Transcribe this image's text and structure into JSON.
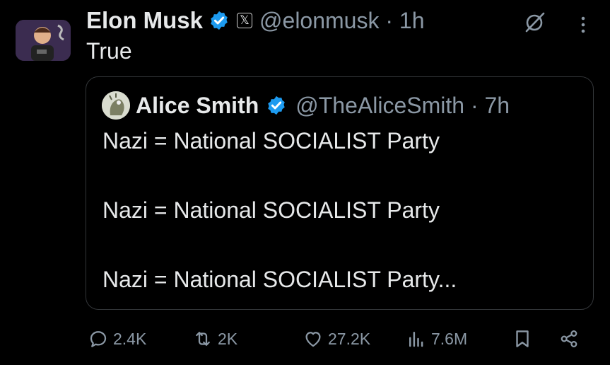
{
  "tweet": {
    "author_name": "Elon Musk",
    "handle_time": "@elonmusk · 1h",
    "text": "True",
    "x_badge": "𝕏"
  },
  "quote": {
    "author_name": "Alice Smith",
    "handle_time": "@TheAliceSmith · 7h",
    "lines": [
      "Nazi = National SOCIALIST Party",
      "Nazi = National SOCIALIST Party",
      "Nazi = National SOCIALIST Party..."
    ]
  },
  "actions": {
    "replies": "2.4K",
    "reposts": "2K",
    "likes": "27.2K",
    "views": "7.6M"
  },
  "colors": {
    "background": "#000000",
    "text": "#e7e9ea",
    "secondary": "#8b98a5",
    "verified": "#1d9bf0",
    "border": "#333639"
  },
  "icons": [
    "verified-badge-icon",
    "x-logo-icon",
    "grok-icon",
    "more-icon",
    "reply-icon",
    "repost-icon",
    "like-icon",
    "views-icon",
    "bookmark-icon",
    "share-icon"
  ]
}
